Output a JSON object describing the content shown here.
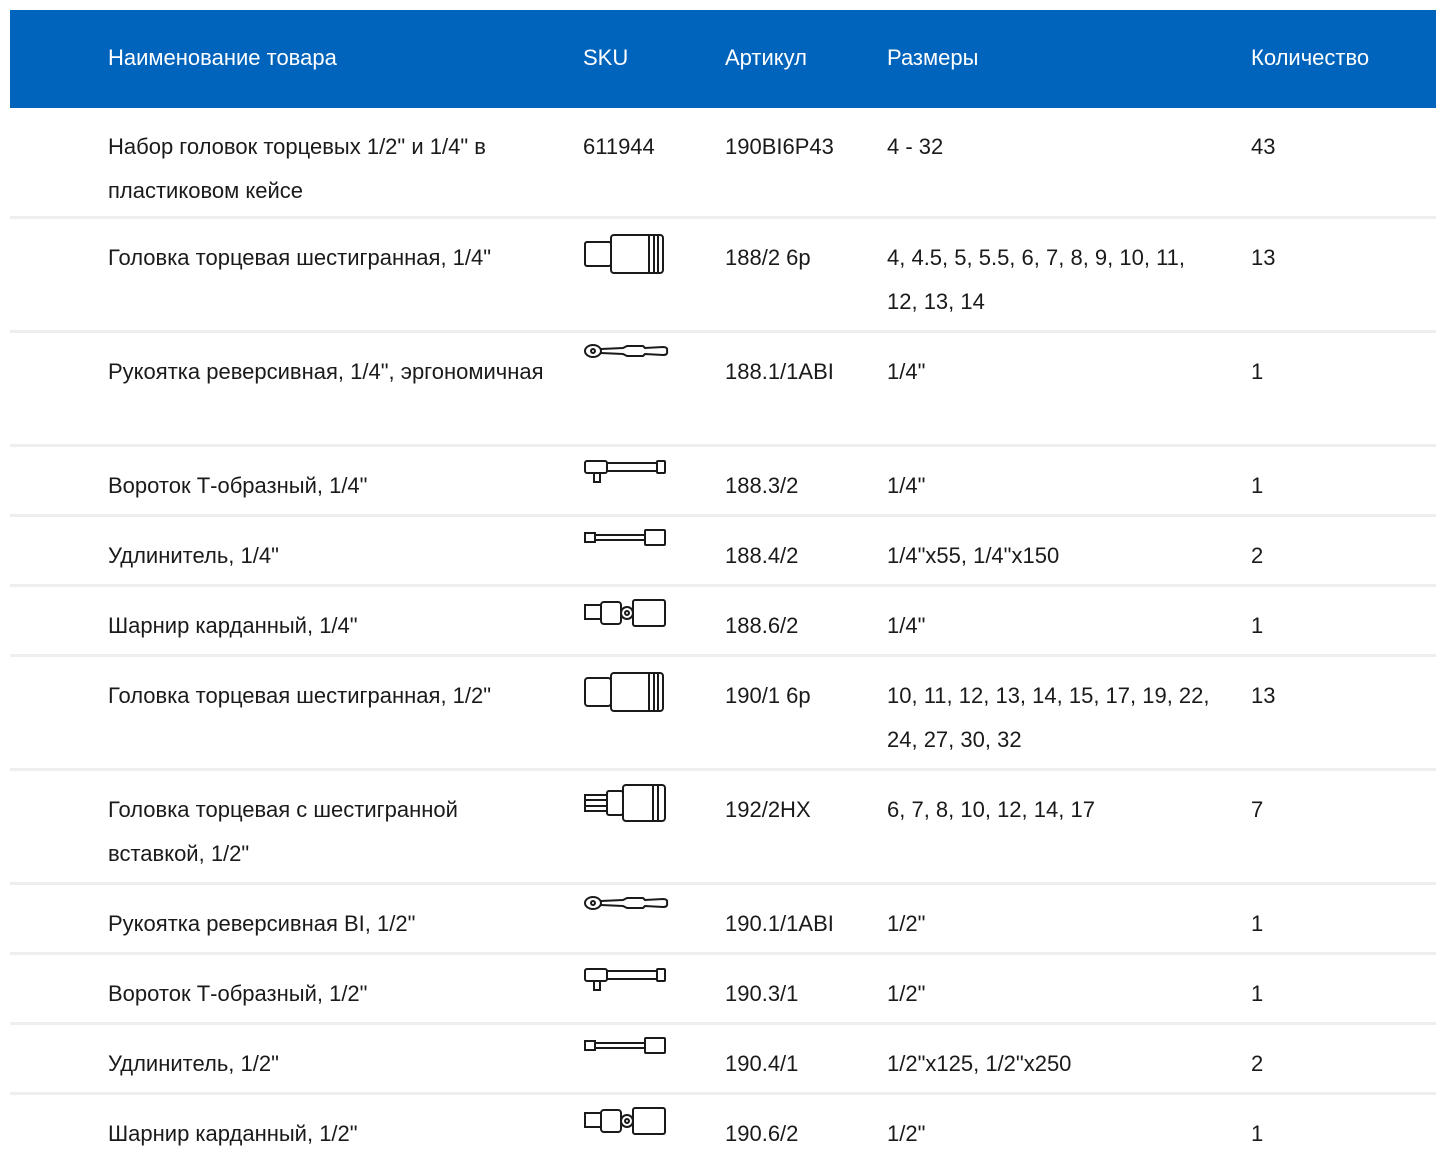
{
  "header": {
    "name": "Наименование товара",
    "sku": "SKU",
    "article": "Артикул",
    "sizes": "Размеры",
    "quantity": "Количество",
    "background_color": "#0064BD"
  },
  "rows": [
    {
      "name": "Набор головок торцевых 1/2\" и 1/4\" в пластиковом кейсе",
      "sku": "611944",
      "article": "190BI6P43",
      "sizes": "4 - 32",
      "quantity": "43"
    },
    {
      "name": "Головка торцевая шестигранная, 1/4\"",
      "sku_icon": "socket-icon",
      "article": "188/2 6р",
      "sizes": "4, 4.5, 5, 5.5, 6, 7, 8, 9, 10, 11, 12, 13, 14",
      "quantity": "13"
    },
    {
      "name": "Рукоятка реверсивная, 1/4\", эргономичная",
      "sku_icon": "ratchet-icon",
      "article": "188.1/1ABI",
      "sizes": "1/4\"",
      "quantity": "1"
    },
    {
      "name": "Вороток Т-образный, 1/4\"",
      "sku_icon": "t-handle-icon",
      "article": "188.3/2",
      "sizes": "1/4\"",
      "quantity": "1"
    },
    {
      "name": "Удлинитель, 1/4\"",
      "sku_icon": "extension-icon",
      "article": "188.4/2",
      "sizes": "1/4\"x55, 1/4\"x150",
      "quantity": "2"
    },
    {
      "name": "Шарнир карданный, 1/4\"",
      "sku_icon": "universal-joint-icon",
      "article": "188.6/2",
      "sizes": "1/4\"",
      "quantity": "1"
    },
    {
      "name": "Головка торцевая шестигранная, 1/2\"",
      "sku_icon": "socket-icon",
      "article": "190/1 6р",
      "sizes": "10, 11, 12, 13, 14, 15, 17, 19, 22, 24, 27, 30, 32",
      "quantity": "13"
    },
    {
      "name": "Головка торцевая с шестигранной вставкой, 1/2\"",
      "sku_icon": "hex-bit-socket-icon",
      "article": "192/2HX",
      "sizes": "6, 7, 8, 10, 12, 14, 17",
      "quantity": "7"
    },
    {
      "name": "Рукоятка реверсивная BI, 1/2\"",
      "sku_icon": "ratchet-icon",
      "article": "190.1/1ABI",
      "sizes": "1/2\"",
      "quantity": "1"
    },
    {
      "name": "Вороток Т-образный, 1/2\"",
      "sku_icon": "t-handle-icon",
      "article": "190.3/1",
      "sizes": "1/2\"",
      "quantity": "1"
    },
    {
      "name": "Удлинитель, 1/2\"",
      "sku_icon": "extension-icon",
      "article": "190.4/1",
      "sizes": "1/2\"x125, 1/2\"x250",
      "quantity": "2"
    },
    {
      "name": "Шарнир карданный, 1/2\"",
      "sku_icon": "universal-joint-icon",
      "article": "190.6/2",
      "sizes": "1/2\"",
      "quantity": "1"
    }
  ]
}
